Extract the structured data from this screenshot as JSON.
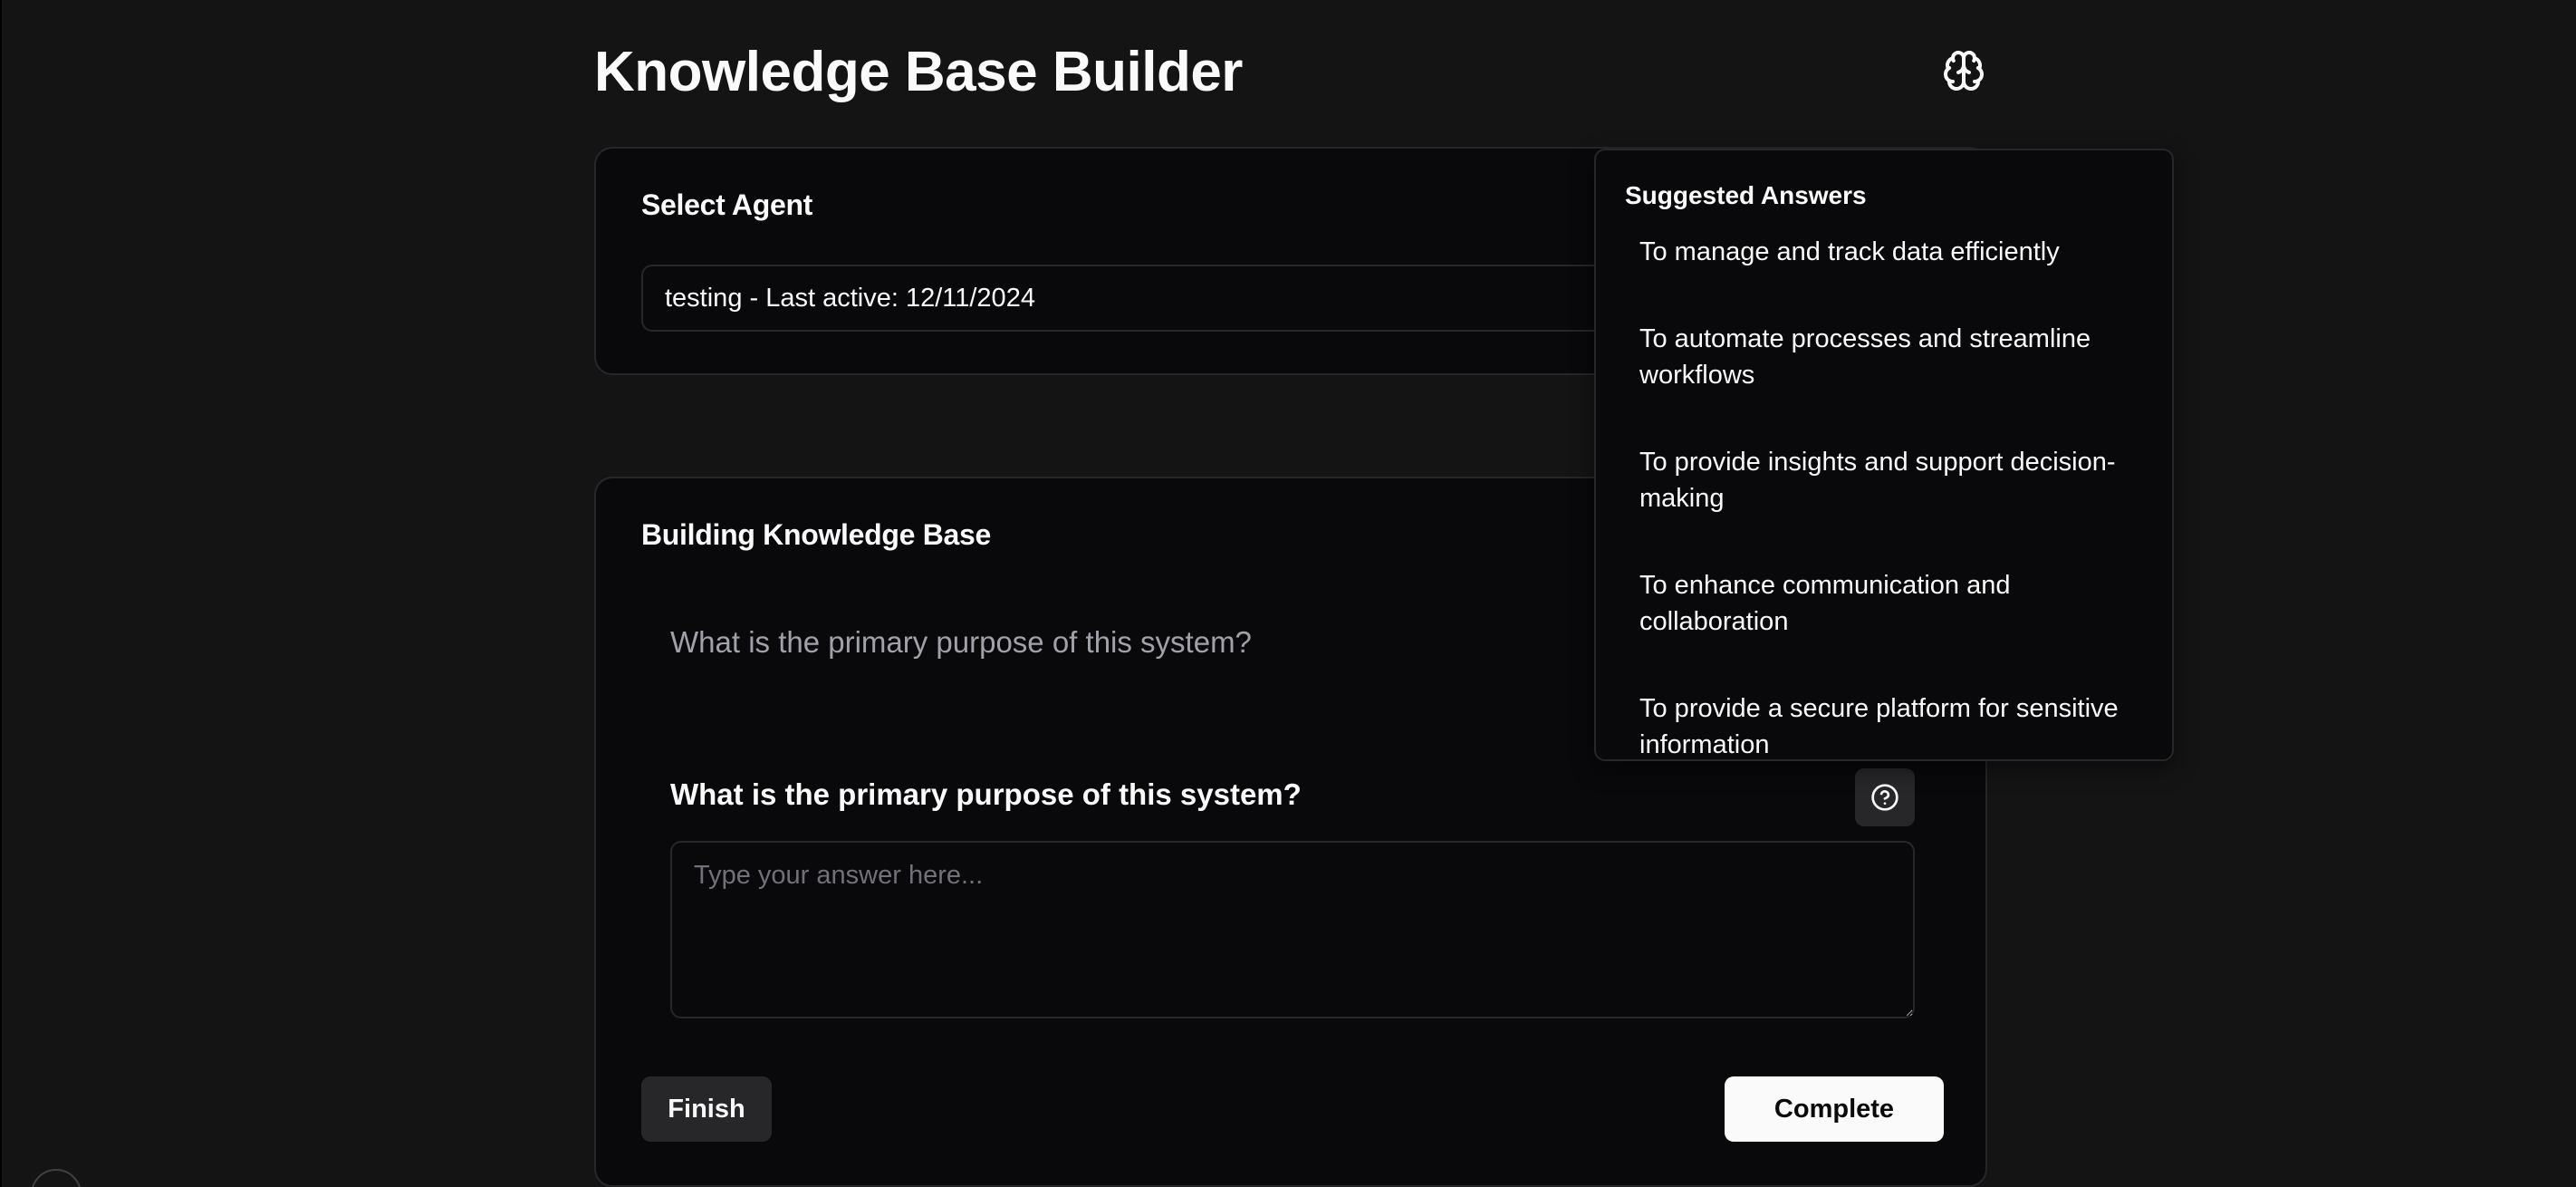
{
  "header": {
    "title": "Knowledge Base Builder",
    "icon": "brain-icon"
  },
  "agent_card": {
    "title": "Select Agent",
    "selected_agent": "testing - Last active: 12/11/2024"
  },
  "kb_card": {
    "title": "Building Knowledge Base",
    "question_preview": "What is the primary purpose of this system?",
    "question_label": "What is the primary purpose of this system?",
    "help_icon": "help-circle-icon",
    "answer_placeholder": "Type your answer here...",
    "answer_value": "",
    "finish_label": "Finish",
    "complete_label": "Complete"
  },
  "suggestions": {
    "title": "Suggested Answers",
    "items": [
      "To manage and track data efficiently",
      "To automate processes and streamline workflows",
      "To provide insights and support decision-making",
      "To enhance communication and collaboration",
      "To provide a secure platform for sensitive information"
    ]
  },
  "colors": {
    "background": "#141414",
    "card": "#09090b",
    "border": "#27272a",
    "primary_button": "#fafafa",
    "secondary_button": "#27272a",
    "muted_text": "#a1a1aa"
  }
}
